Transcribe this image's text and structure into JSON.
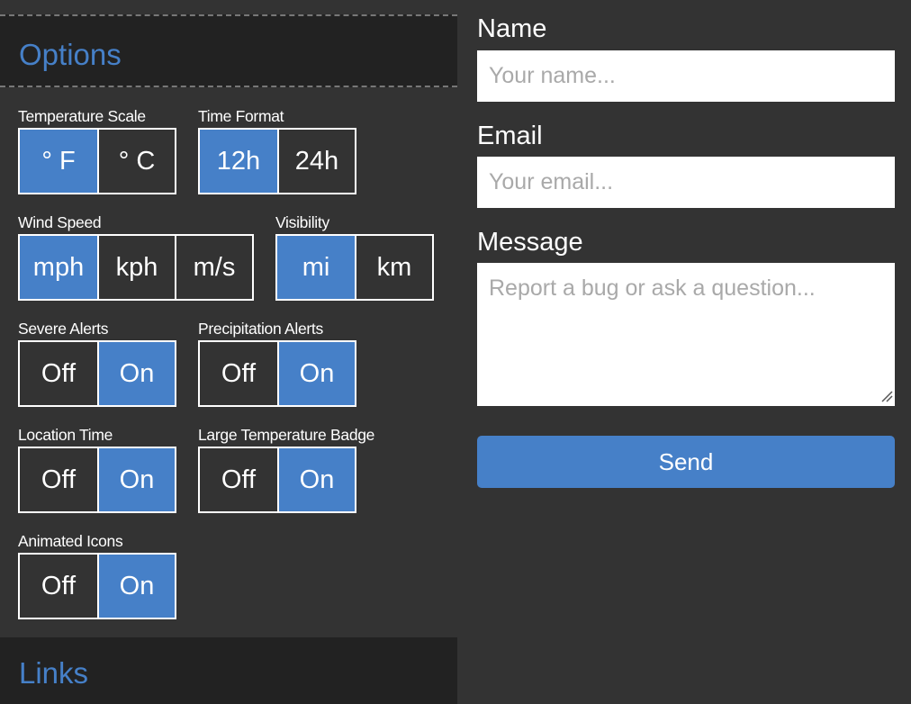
{
  "options": {
    "title": "Options",
    "groups": {
      "temperature_scale": {
        "label": "Temperature Scale",
        "options": [
          "° F",
          "° C"
        ],
        "selected": "° F"
      },
      "time_format": {
        "label": "Time Format",
        "options": [
          "12h",
          "24h"
        ],
        "selected": "12h"
      },
      "wind_speed": {
        "label": "Wind Speed",
        "options": [
          "mph",
          "kph",
          "m/s"
        ],
        "selected": "mph"
      },
      "visibility": {
        "label": "Visibility",
        "options": [
          "mi",
          "km"
        ],
        "selected": "mi"
      },
      "severe_alerts": {
        "label": "Severe Alerts",
        "options": [
          "Off",
          "On"
        ],
        "selected": "On"
      },
      "precipitation_alerts": {
        "label": "Precipitation Alerts",
        "options": [
          "Off",
          "On"
        ],
        "selected": "On"
      },
      "location_time": {
        "label": "Location Time",
        "options": [
          "Off",
          "On"
        ],
        "selected": "On"
      },
      "large_temperature_badge": {
        "label": "Large Temperature Badge",
        "options": [
          "Off",
          "On"
        ],
        "selected": "On"
      },
      "animated_icons": {
        "label": "Animated Icons",
        "options": [
          "Off",
          "On"
        ],
        "selected": "On"
      }
    }
  },
  "links": {
    "title": "Links"
  },
  "form": {
    "name_label": "Name",
    "name_placeholder": "Your name...",
    "email_label": "Email",
    "email_placeholder": "Your email...",
    "message_label": "Message",
    "message_placeholder": "Report a bug or ask a question...",
    "send_label": "Send"
  },
  "colors": {
    "accent": "#4680c8",
    "panel_bg": "#333333",
    "header_bg": "#222222",
    "text": "#ffffff"
  }
}
